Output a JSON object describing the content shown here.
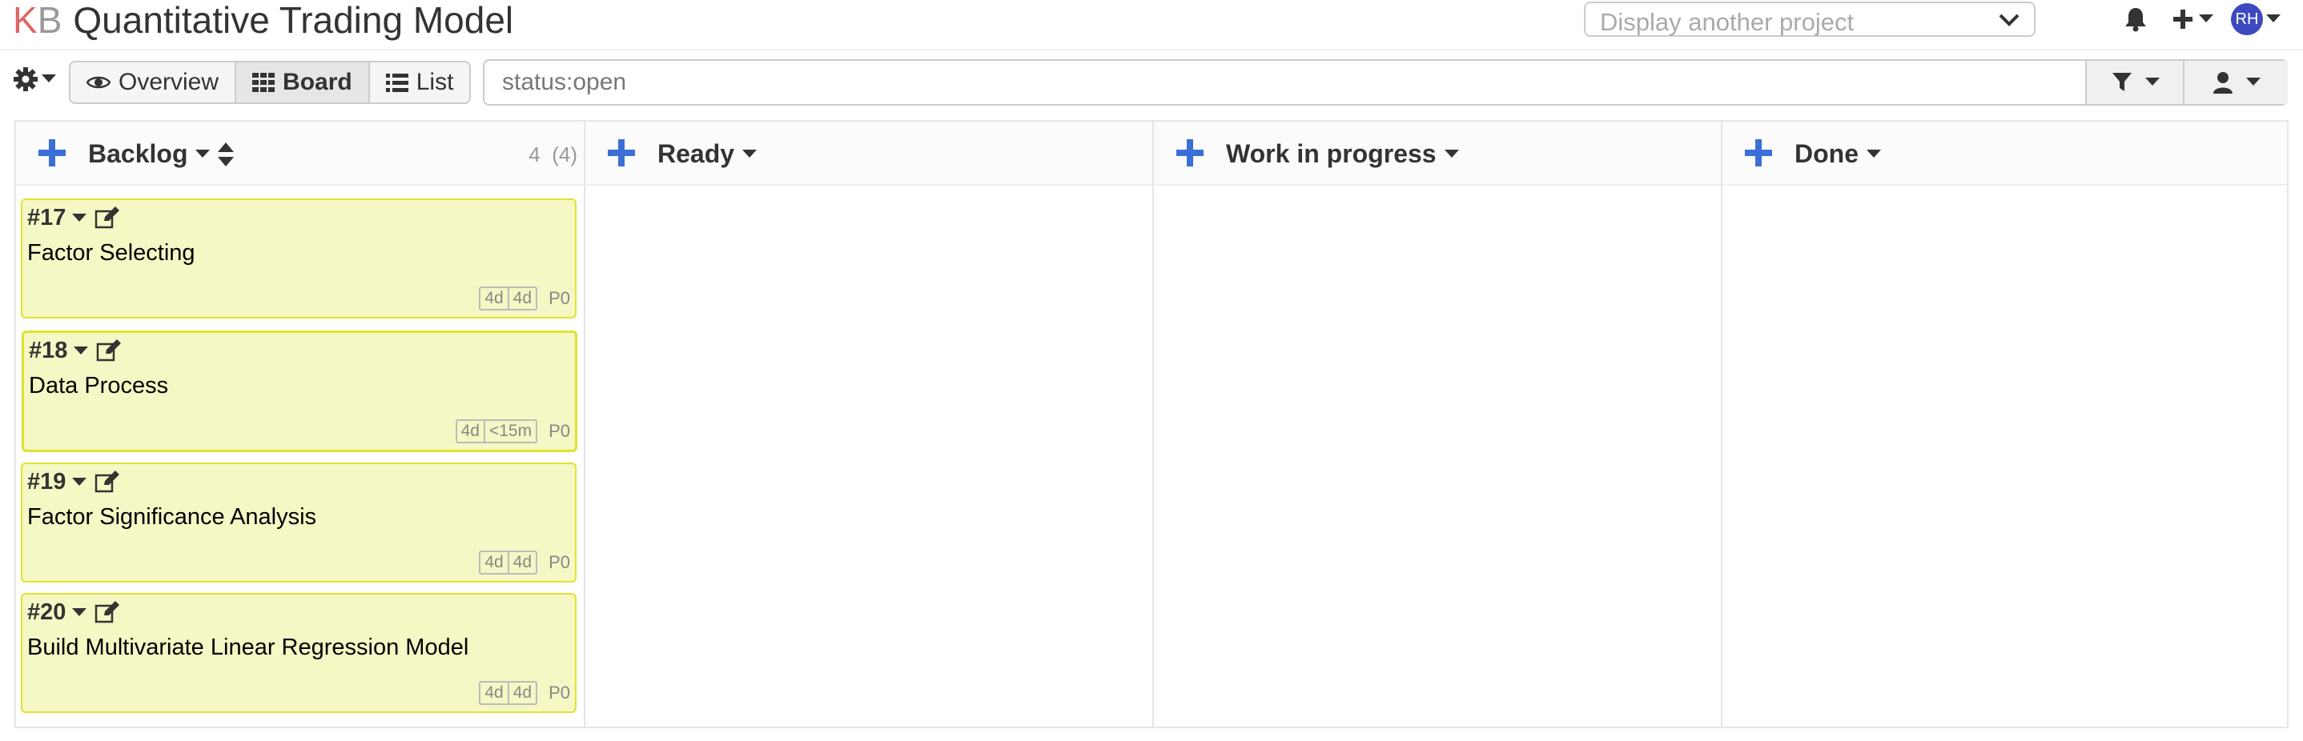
{
  "header": {
    "logo_k": "K",
    "logo_b": "B",
    "project_title": "Quantitative Trading Model",
    "project_select_placeholder": "Display another project",
    "avatar_initials": "RH"
  },
  "toolbar": {
    "views": [
      {
        "label": "Overview",
        "icon": "eye-icon"
      },
      {
        "label": "Board",
        "icon": "th-icon",
        "active": true
      },
      {
        "label": "List",
        "icon": "list-icon"
      }
    ],
    "search_value": "status:open"
  },
  "board": {
    "columns": [
      {
        "title": "Backlog",
        "count": "4",
        "total": "(4)"
      },
      {
        "title": "Ready"
      },
      {
        "title": "Work in progress"
      },
      {
        "title": "Done"
      }
    ],
    "cards": [
      {
        "id": "#17",
        "title": "Factor Selecting",
        "time_a": "4d",
        "time_b": "4d",
        "priority": "P0"
      },
      {
        "id": "#18",
        "title": "Data Process",
        "time_a": "4d",
        "time_b": "<15m",
        "priority": "P0"
      },
      {
        "id": "#19",
        "title": "Factor Significance Analysis",
        "time_a": "4d",
        "time_b": "4d",
        "priority": "P0"
      },
      {
        "id": "#20",
        "title": "Build Multivariate Linear Regression Model",
        "time_a": "4d",
        "time_b": "4d",
        "priority": "P0"
      }
    ]
  },
  "colors": {
    "accent_blue": "#3b6fd6",
    "card_bg": "#f5f7c4",
    "card_border": "#dfe32d",
    "logo_k": "#d66666",
    "avatar_bg": "#3c49bf"
  }
}
